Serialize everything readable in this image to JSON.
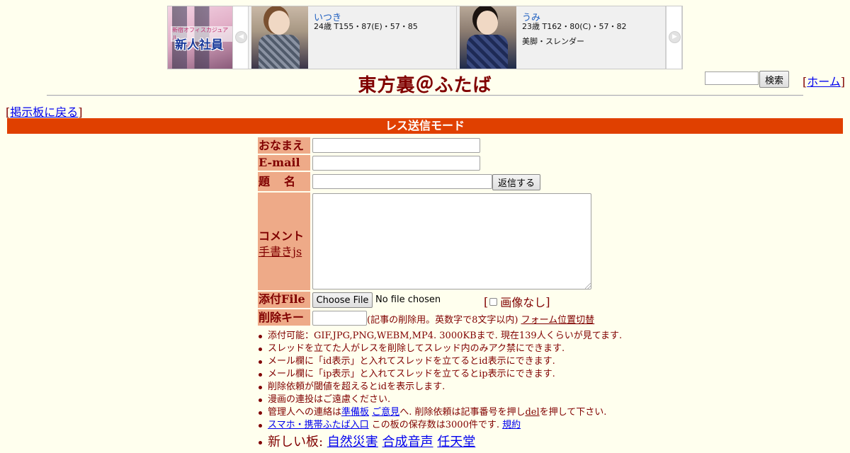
{
  "banner": {
    "ad": {
      "tag": "新宿オフィスカジュアル",
      "title": "新人社員"
    },
    "cards": [
      {
        "name": "いつき",
        "spec": "24歳 T155・87(E)・57・85",
        "desc": ""
      },
      {
        "name": "うみ",
        "spec": "23歳 T162・80(C)・57・82",
        "desc": "美脚・スレンダー"
      }
    ],
    "prev_arrow": "◀",
    "next_arrow": "▶"
  },
  "header": {
    "title": "東方裏＠ふたば",
    "search_button": "検索",
    "home_link": "ホーム",
    "back_link": "掲示板に戻る"
  },
  "mode_bar": "レス送信モード",
  "form": {
    "labels": {
      "name": "おなまえ",
      "email": "E-mail",
      "subject": "題名",
      "comment": "コメント",
      "tegaki": "手書きjs",
      "file": "添付File",
      "delete_key": "削除キー"
    },
    "reply_button": "返信する",
    "file_button": "Choose File",
    "file_status": "No file chosen",
    "no_image": "画像なし",
    "delete_note": "(記事の削除用。英数字で8文字以内)",
    "form_toggle": "フォーム位置切替"
  },
  "notes": {
    "n1": "添付可能：GIF,JPG,PNG,WEBM,MP4. 3000KBまで. 現在139人くらいが見てます.",
    "n2": "スレッドを立てた人がレスを削除してスレッド内のみアク禁にできます.",
    "n3": "メール欄に「id表示」と入れてスレッドを立てるとid表示にできます.",
    "n4": "メール欄に「ip表示」と入れてスレッドを立てるとip表示にできます.",
    "n5": "削除依頼が閾値を超えるとidを表示します.",
    "n6": "漫画の連投はご遠慮ください.",
    "n7_pre": "管理人への連絡は",
    "n7_link1": "準備板",
    "n7_link2": "ご意見",
    "n7_mid": "へ. 削除依頼は記事番号を押し",
    "n7_link3": "del",
    "n7_post": "を押して下さい.",
    "n8_link": "スマホ・携帯ふたば入口",
    "n8_mid": "この板の保存数は3000件です.",
    "n8_link2": "規約",
    "n9_label": "新しい板:",
    "n9_boards": [
      "自然災害",
      "合成音声",
      "任天堂"
    ]
  },
  "colors": {
    "background": "#ffffee",
    "text": "#800000",
    "label_bg": "#eeaa88",
    "mode_bar": "#e04000",
    "link": "#0000ee"
  }
}
